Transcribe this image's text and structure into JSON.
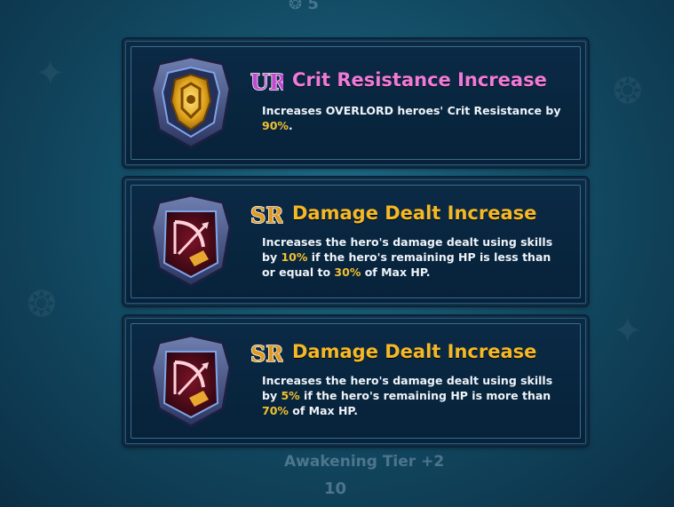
{
  "background": {
    "top_badge": "5",
    "bottom_title": "Awakening Tier +2",
    "bottom_number": "10"
  },
  "colors": {
    "ur_title": "#f07ad8",
    "sr_title": "#f5b826",
    "highlight": "#f0c030",
    "text": "#eef3f8"
  },
  "skills": [
    {
      "grade": "UR",
      "icon": "gold-shield-emblem-icon",
      "title": "Crit Resistance Increase",
      "desc": {
        "p1": "Increases OVERLORD heroes' Crit Resistance by ",
        "v1": "90%",
        "p2": "."
      }
    },
    {
      "grade": "SR",
      "icon": "bow-emblem-icon",
      "title": "Damage Dealt Increase",
      "desc": {
        "p1": "Increases the hero's damage dealt using skills by ",
        "v1": "10%",
        "p2": " if the hero's remaining HP is less than or equal to ",
        "v2": "30%",
        "p3": " of Max HP."
      }
    },
    {
      "grade": "SR",
      "icon": "bow-emblem-icon",
      "title": "Damage Dealt Increase",
      "desc": {
        "p1": "Increases the hero's damage dealt using skills by ",
        "v1": "5%",
        "p2": " if the hero's remaining HP is more than ",
        "v2": "70%",
        "p3": " of Max HP."
      }
    }
  ]
}
